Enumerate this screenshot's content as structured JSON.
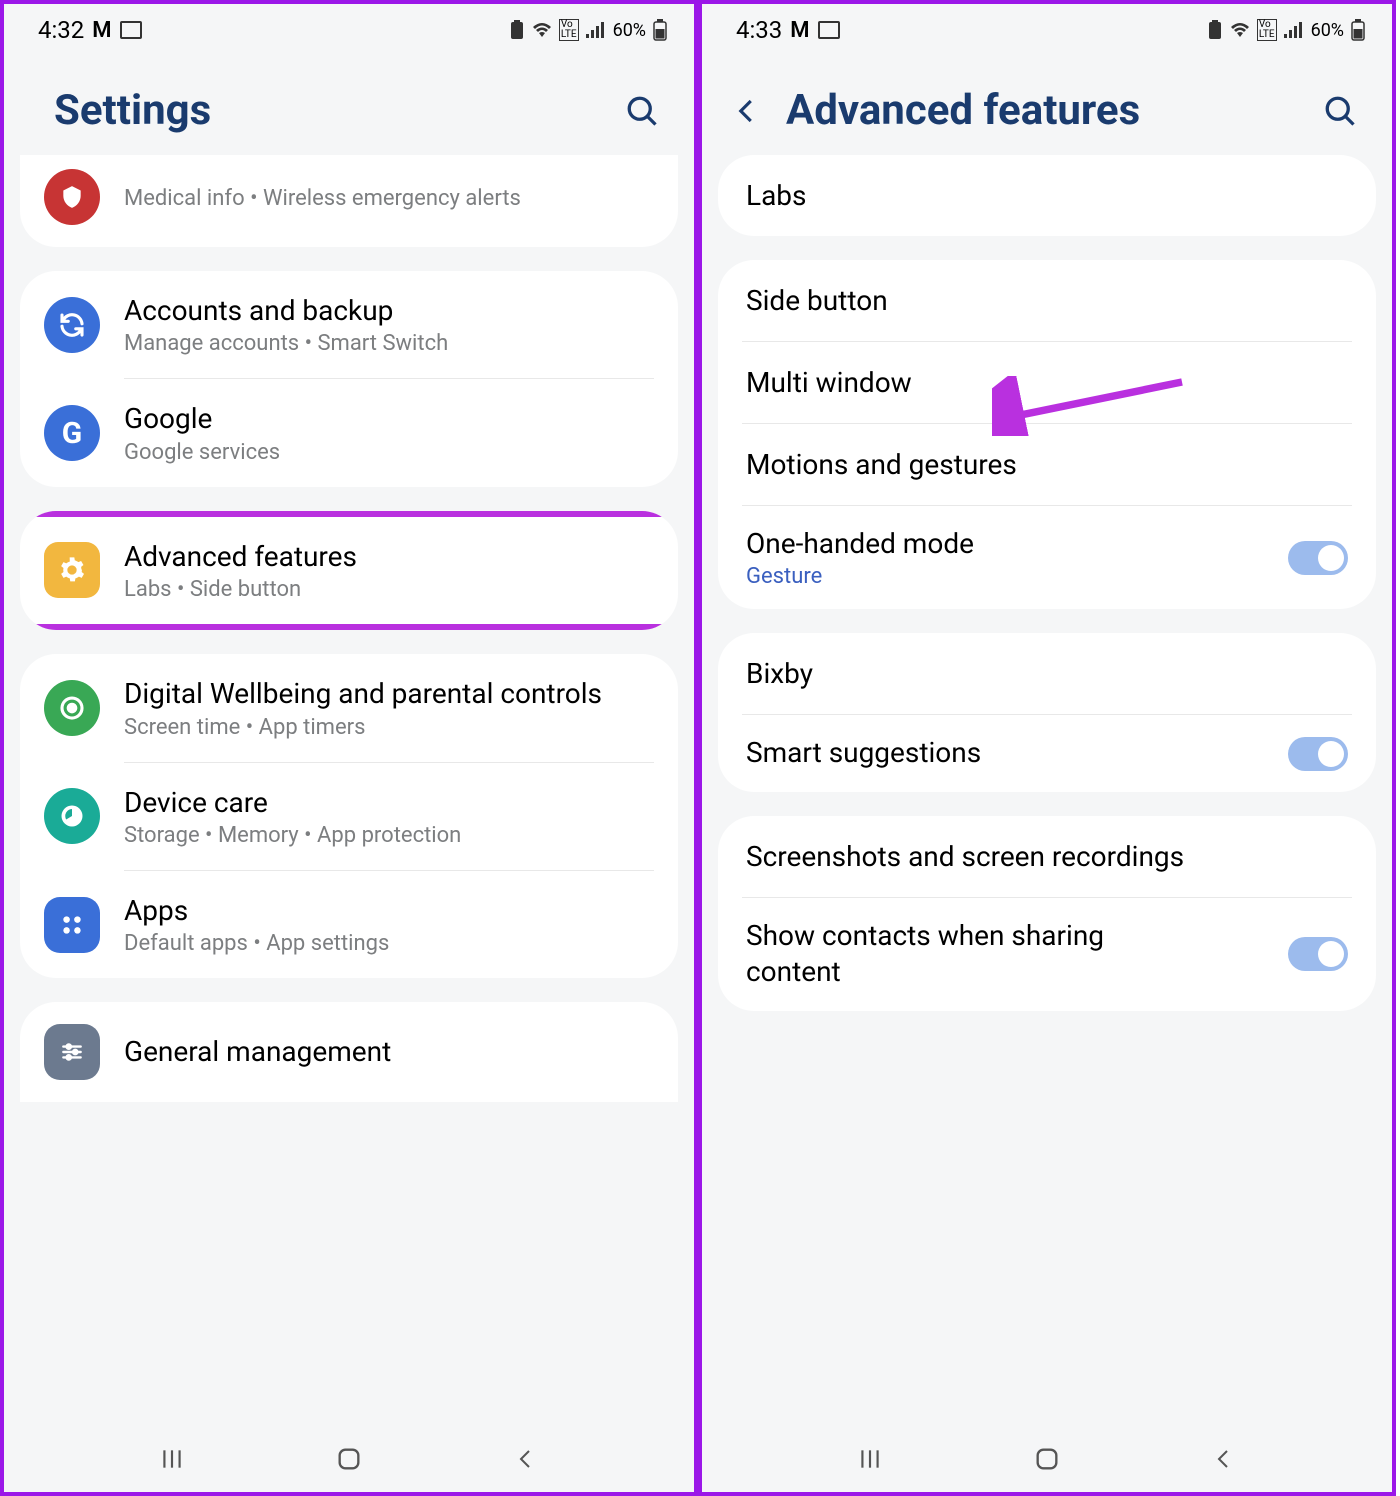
{
  "left": {
    "status": {
      "time": "4:32",
      "battery": "60%"
    },
    "header": {
      "title": "Settings"
    },
    "partial_top": {
      "subtitle": "Medical info  •  Wireless emergency alerts"
    },
    "group1": {
      "accounts": {
        "title": "Accounts and backup",
        "subtitle": "Manage accounts  •  Smart Switch"
      },
      "google": {
        "title": "Google",
        "subtitle": "Google services"
      }
    },
    "advanced": {
      "title": "Advanced features",
      "subtitle": "Labs  •  Side button"
    },
    "group3": {
      "wellbeing": {
        "title": "Digital Wellbeing and parental controls",
        "subtitle": "Screen time  •  App timers"
      },
      "devicecare": {
        "title": "Device care",
        "subtitle": "Storage  •  Memory  •  App protection"
      },
      "apps": {
        "title": "Apps",
        "subtitle": "Default apps  •  App settings"
      }
    },
    "group4": {
      "general": {
        "title": "General management"
      }
    }
  },
  "right": {
    "status": {
      "time": "4:33",
      "battery": "60%"
    },
    "header": {
      "title": "Advanced features"
    },
    "items": {
      "labs": "Labs",
      "side_button": "Side button",
      "multi_window": "Multi window",
      "motions": "Motions and gestures",
      "one_handed": {
        "title": "One-handed mode",
        "sub": "Gesture"
      },
      "bixby": "Bixby",
      "smart_suggestions": "Smart suggestions",
      "screenshots": "Screenshots and screen recordings",
      "show_contacts": "Show contacts when sharing content"
    }
  }
}
